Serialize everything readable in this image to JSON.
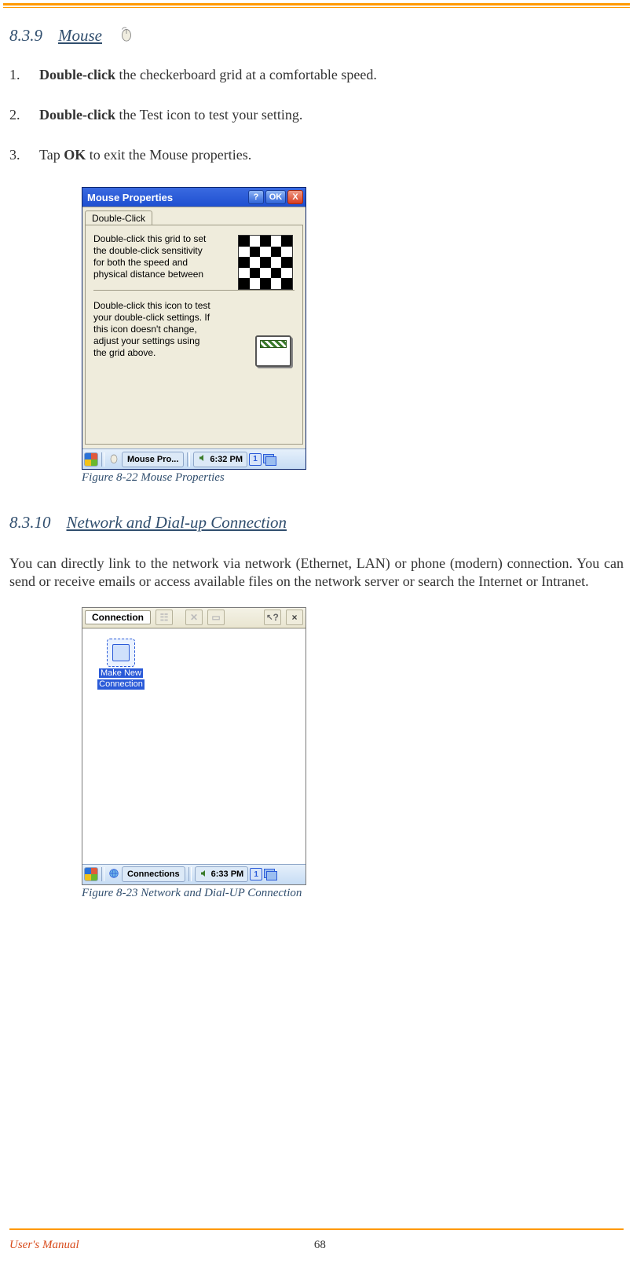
{
  "section1": {
    "num": "8.3.9",
    "title": "Mouse"
  },
  "steps": [
    {
      "n": "1.",
      "bold": "Double-click",
      "rest": " the checkerboard grid at a comfortable speed."
    },
    {
      "n": "2.",
      "bold": "Double-click",
      "rest": " the Test icon to test your setting."
    },
    {
      "n": "3.",
      "pre": "Tap ",
      "bold": "OK",
      "rest": " to exit the Mouse properties."
    }
  ],
  "mp": {
    "title": "Mouse Properties",
    "help": "?",
    "ok": "OK",
    "close": "X",
    "tab": "Double-Click",
    "p1": "Double-click this grid to set the double-click sensitivity for both the speed and physical distance between",
    "p2": "Double-click this icon to test your double-click settings. If this icon doesn't change, adjust your settings using the grid above.",
    "taskbar_app": "Mouse Pro...",
    "time": "6:32 PM",
    "kb": "1"
  },
  "caption1": "Figure 8-22 Mouse Properties",
  "section2": {
    "num": "8.3.10",
    "title": "Network and Dial-up Connection"
  },
  "para1": "You can directly link to the network via network (Ethernet, LAN) or phone (modern) connection. You can send or receive emails or access available files on the network server or search the Internet or Intranet.",
  "cn": {
    "title": "Connection",
    "help": "?",
    "close": "×",
    "icon_label_l1": "Make New",
    "icon_label_l2": "Connection",
    "taskbar_app": "Connections",
    "time": "6:33 PM",
    "kb": "1"
  },
  "caption2": "Figure 8-23 Network and Dial-UP Connection",
  "footer": {
    "label": "User's Manual",
    "page": "68"
  }
}
